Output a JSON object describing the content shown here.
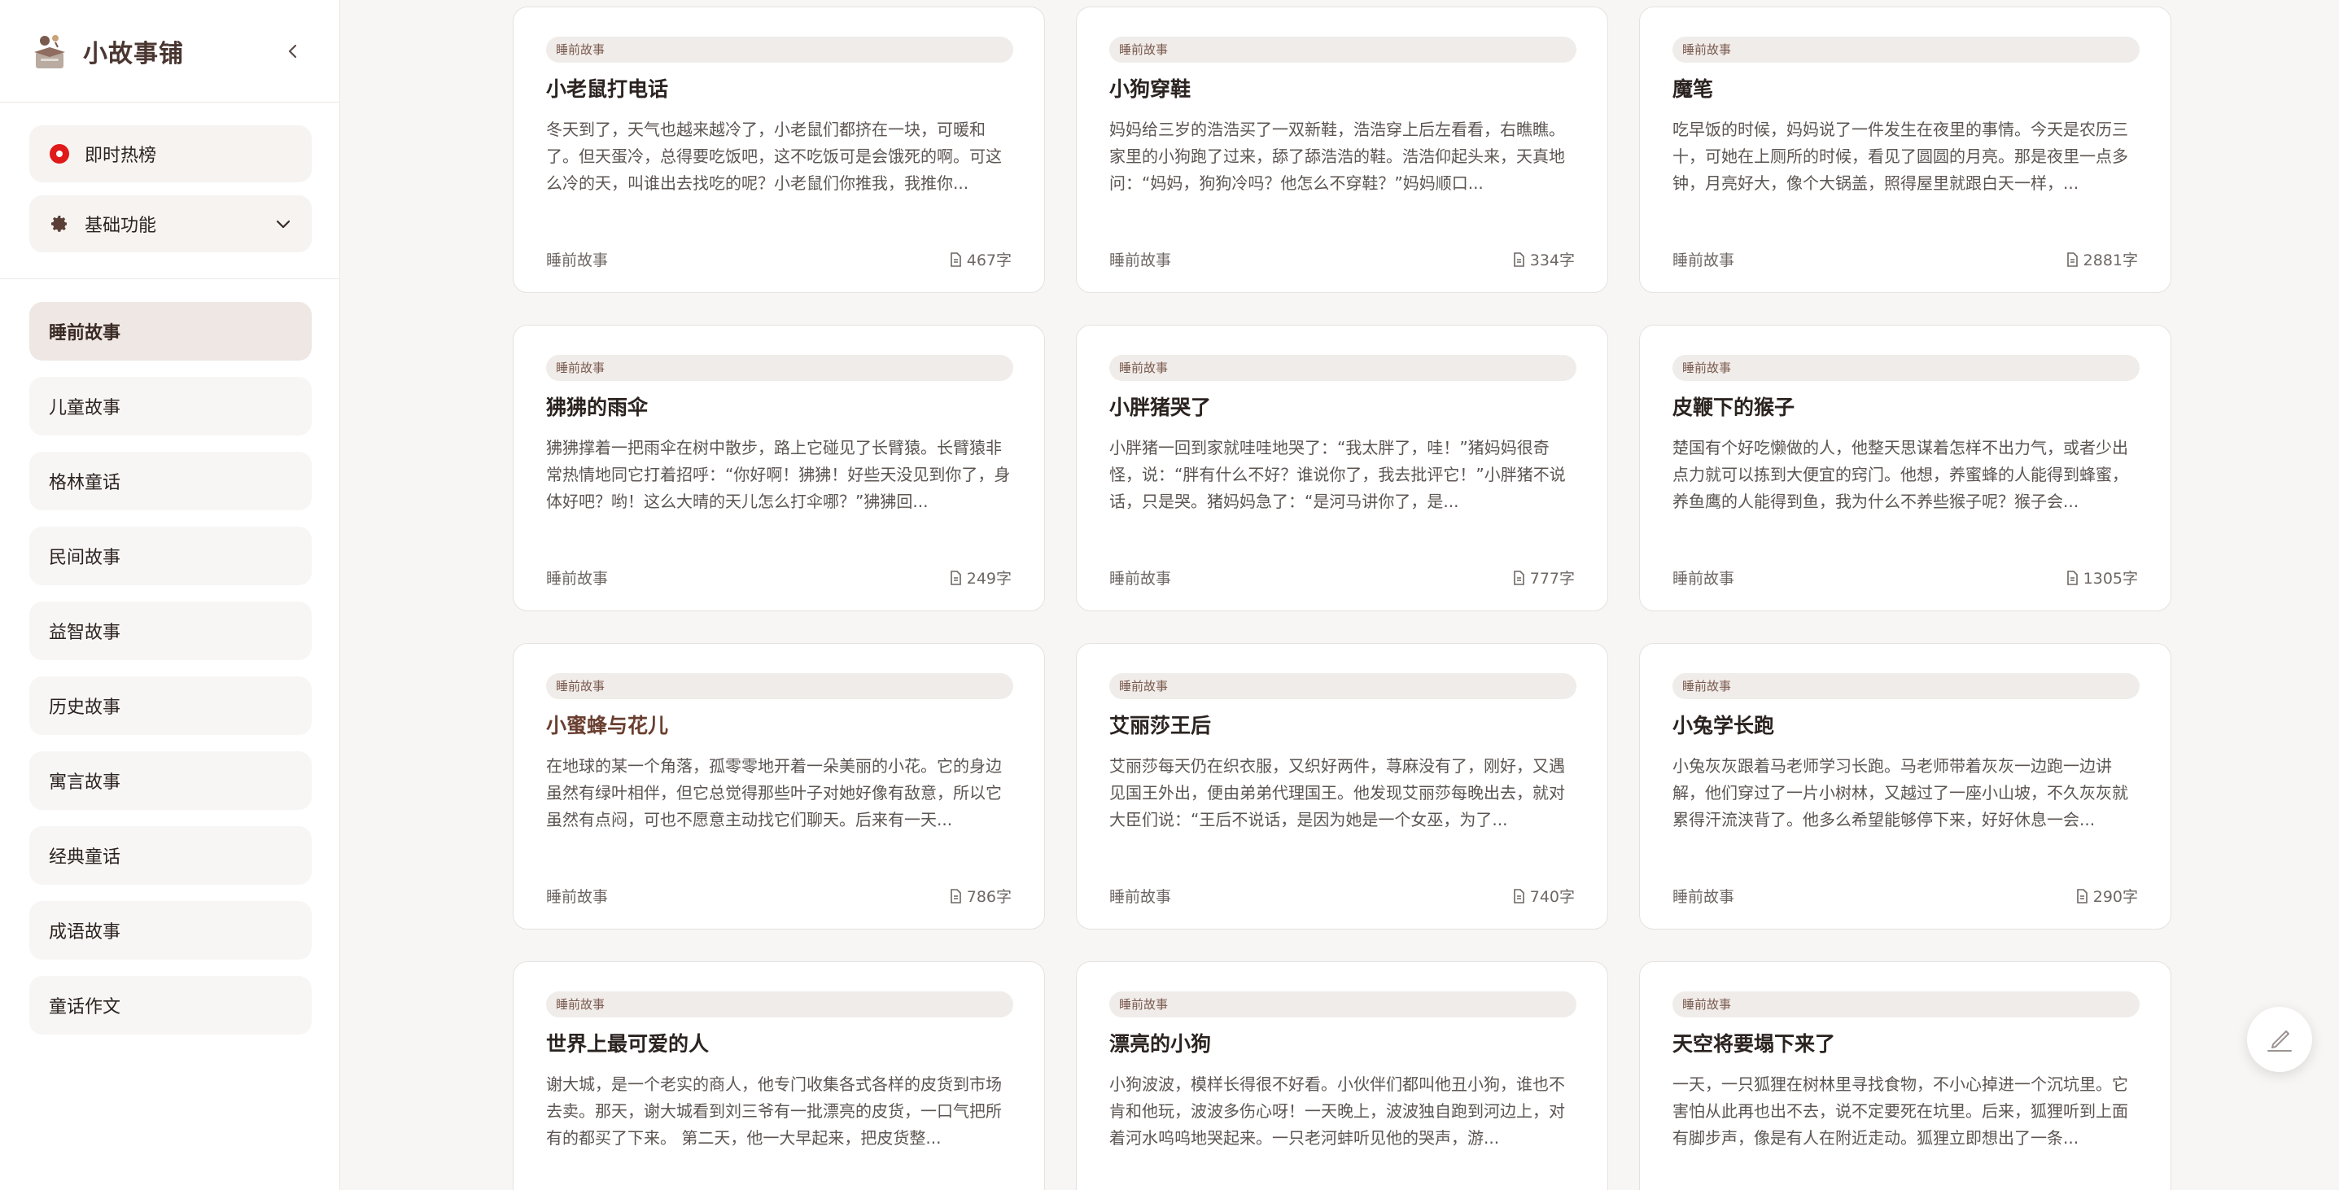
{
  "app": {
    "title": "小故事铺"
  },
  "top_menu": {
    "hot_label": "即时热榜",
    "basic_label": "基础功能"
  },
  "categories": [
    {
      "label": "睡前故事",
      "active": true
    },
    {
      "label": "儿童故事"
    },
    {
      "label": "格林童话"
    },
    {
      "label": "民间故事"
    },
    {
      "label": "益智故事"
    },
    {
      "label": "历史故事"
    },
    {
      "label": "寓言故事"
    },
    {
      "label": "经典童话"
    },
    {
      "label": "成语故事"
    },
    {
      "label": "童话作文"
    }
  ],
  "stories": [
    {
      "tag": "睡前故事",
      "title": "小老鼠打电话",
      "excerpt": "冬天到了，天气也越来越冷了，小老鼠们都挤在一块，可暖和了。但天蛋冷，总得要吃饭吧，这不吃饭可是会饿死的啊。可这么冷的天，叫谁出去找吃的呢？小老鼠们你推我，我推你...",
      "category": "睡前故事",
      "count": "467字"
    },
    {
      "tag": "睡前故事",
      "title": "小狗穿鞋",
      "excerpt": "妈妈给三岁的浩浩买了一双新鞋，浩浩穿上后左看看，右瞧瞧。家里的小狗跑了过来，舔了舔浩浩的鞋。浩浩仰起头来，天真地问：“妈妈，狗狗冷吗？他怎么不穿鞋？”妈妈顺口...",
      "category": "睡前故事",
      "count": "334字"
    },
    {
      "tag": "睡前故事",
      "title": "魔笔",
      "excerpt": "吃早饭的时候，妈妈说了一件发生在夜里的事情。今天是农历三十，可她在上厕所的时候，看见了圆圆的月亮。那是夜里一点多钟，月亮好大，像个大锅盖，照得屋里就跟白天一样，...",
      "category": "睡前故事",
      "count": "2881字"
    },
    {
      "tag": "睡前故事",
      "title": "狒狒的雨伞",
      "excerpt": "狒狒撑着一把雨伞在树中散步，路上它碰见了长臂猿。长臂猿非常热情地同它打着招呼：“你好啊！狒狒！好些天没见到你了，身体好吧？哟！这么大晴的天儿怎么打伞哪？”狒狒回...",
      "category": "睡前故事",
      "count": "249字"
    },
    {
      "tag": "睡前故事",
      "title": "小胖猪哭了",
      "excerpt": "小胖猪一回到家就哇哇地哭了：“我太胖了，哇！”猪妈妈很奇怪，说：“胖有什么不好？谁说你了，我去批评它！”小胖猪不说话，只是哭。猪妈妈急了：“是河马讲你了，是...",
      "category": "睡前故事",
      "count": "777字"
    },
    {
      "tag": "睡前故事",
      "title": "皮鞭下的猴子",
      "excerpt": "楚国有个好吃懒做的人，他整天思谋着怎样不出力气，或者少出点力就可以拣到大便宜的窍门。他想，养蜜蜂的人能得到蜂蜜，养鱼鹰的人能得到鱼，我为什么不养些猴子呢？猴子会...",
      "category": "睡前故事",
      "count": "1305字"
    },
    {
      "tag": "睡前故事",
      "title": "小蜜蜂与花儿",
      "excerpt": "在地球的某一个角落，孤零零地开着一朵美丽的小花。它的身边虽然有绿叶相伴，但它总觉得那些叶子对她好像有敌意，所以它虽然有点闷，可也不愿意主动找它们聊天。后来有一天...",
      "category": "睡前故事",
      "count": "786字",
      "highlight": true
    },
    {
      "tag": "睡前故事",
      "title": "艾丽莎王后",
      "excerpt": "艾丽莎每天仍在织衣服，又织好两件，荨麻没有了，刚好，又遇见国王外出，便由弟弟代理国王。他发现艾丽莎每晚出去，就对大臣们说：“王后不说话，是因为她是一个女巫，为了...",
      "category": "睡前故事",
      "count": "740字"
    },
    {
      "tag": "睡前故事",
      "title": "小兔学长跑",
      "excerpt": "小兔灰灰跟着马老师学习长跑。马老师带着灰灰一边跑一边讲解，他们穿过了一片小树林，又越过了一座小山坡，不久灰灰就累得汗流浃背了。他多么希望能够停下来，好好休息一会...",
      "category": "睡前故事",
      "count": "290字"
    },
    {
      "tag": "睡前故事",
      "title": "世界上最可爱的人",
      "excerpt": "谢大城，是一个老实的商人，他专门收集各式各样的皮货到市场去卖。那天，谢大城看到刘三爷有一批漂亮的皮货，一口气把所有的都买了下来。 第二天，他一大早起来，把皮货整...",
      "category": "睡前故事",
      "count": ""
    },
    {
      "tag": "睡前故事",
      "title": "漂亮的小狗",
      "excerpt": "小狗波波，模样长得很不好看。小伙伴们都叫他丑小狗，谁也不肯和他玩，波波多伤心呀！一天晚上，波波独自跑到河边上，对着河水呜呜地哭起来。一只老河蚌听见他的哭声，游...",
      "category": "睡前故事",
      "count": ""
    },
    {
      "tag": "睡前故事",
      "title": "天空将要塌下来了",
      "excerpt": "一天，一只狐狸在树林里寻找食物，不小心掉进一个沉坑里。它害怕从此再也出不去，说不定要死在坑里。后来，狐狸听到上面有脚步声，像是有人在附近走动。狐狸立即想出了一条...",
      "category": "睡前故事",
      "count": ""
    }
  ],
  "icons": {
    "logo": "storybook-logo-icon",
    "collapse": "chevron-left-icon",
    "hot": "hot-record-icon",
    "basic": "gear-icon",
    "expand": "chevron-down-icon",
    "word_count": "document-icon",
    "float": "pen-sign-icon"
  },
  "colors": {
    "accent": "#6a3f30",
    "hot": "#e01919",
    "active_bg": "#eee7e3"
  }
}
